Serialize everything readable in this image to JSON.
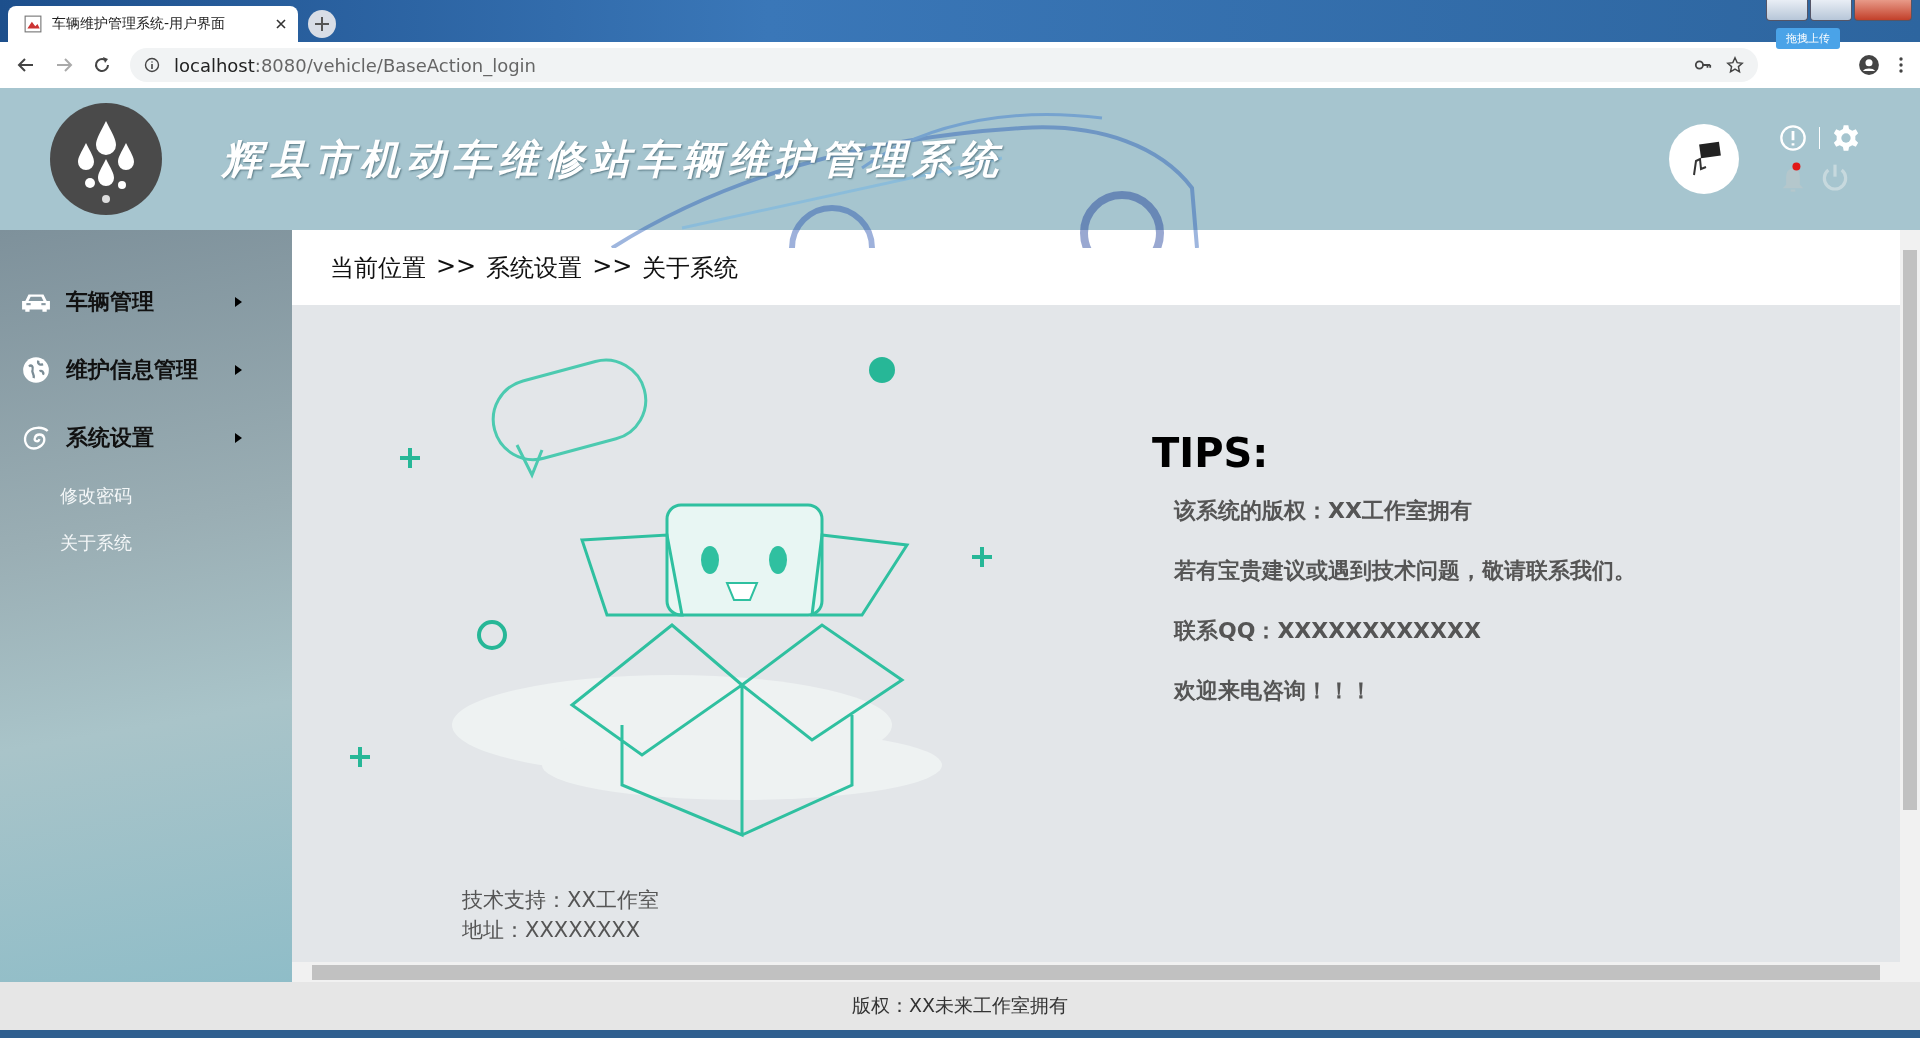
{
  "browser": {
    "tab_title": "车辆维护管理系统-用户界面",
    "url_host": "localhost",
    "url_rest": ":8080/vehicle/BaseAction_login",
    "upload_badge": "拖拽上传"
  },
  "header": {
    "title": "辉县市机动车维修站车辆维护管理系统",
    "notification_dot": true
  },
  "sidebar": {
    "items": [
      {
        "label": "车辆管理"
      },
      {
        "label": "维护信息管理"
      },
      {
        "label": "系统设置",
        "children": [
          {
            "label": "修改密码"
          },
          {
            "label": "关于系统"
          }
        ]
      }
    ]
  },
  "breadcrumb": [
    "当前位置",
    ">>",
    "系统设置",
    ">>",
    "关于系统"
  ],
  "tips": {
    "heading": "TIPS:",
    "lines": [
      "该系统的版权：XX工作室拥有",
      "若有宝贵建议或遇到技术问题，敬请联系我们。",
      "联系QQ：XXXXXXXXXXXX",
      "欢迎来电咨询！！！"
    ]
  },
  "support": [
    "技术支持：XX工作室",
    "地址：XXXXXXXX"
  ],
  "footer": "版权：XX未来工作室拥有"
}
